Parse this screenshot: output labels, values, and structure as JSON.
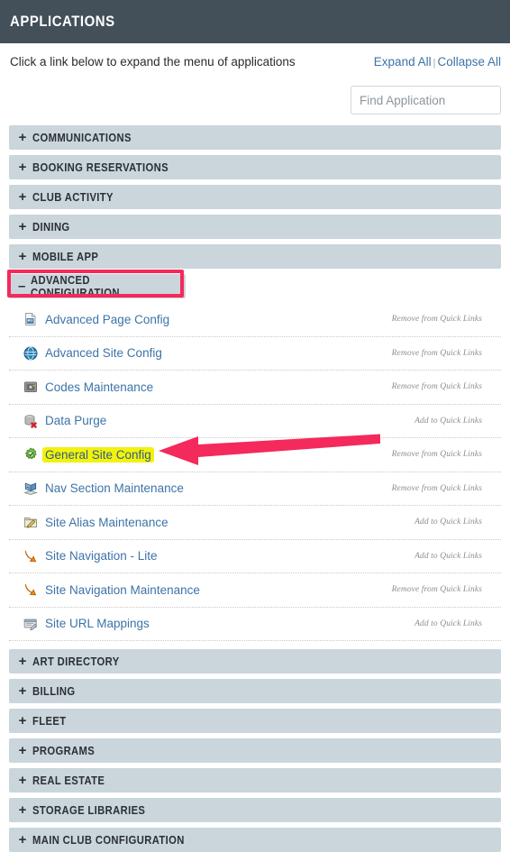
{
  "header": {
    "title": "APPLICATIONS"
  },
  "intro": {
    "hint": "Click a link below to expand the menu of applications",
    "expand_all": "Expand All",
    "separator": "|",
    "collapse_all": "Collapse All"
  },
  "search": {
    "placeholder": "Find Application",
    "value": ""
  },
  "categories_top": [
    {
      "label": "COMMUNICATIONS",
      "sign": "+",
      "expanded": false
    },
    {
      "label": "BOOKING RESERVATIONS",
      "sign": "+",
      "expanded": false
    },
    {
      "label": "CLUB ACTIVITY",
      "sign": "+",
      "expanded": false
    },
    {
      "label": "DINING",
      "sign": "+",
      "expanded": false
    },
    {
      "label": "MOBILE APP",
      "sign": "+",
      "expanded": false
    }
  ],
  "expanded_category": {
    "label": "ADVANCED CONFIGURATION",
    "sign": "–",
    "expanded": true
  },
  "applications": [
    {
      "name": "Advanced Page Config",
      "icon": "page-image-icon",
      "quick_link": "Remove from Quick Links",
      "highlighted": false
    },
    {
      "name": "Advanced Site Config",
      "icon": "globe-icon",
      "quick_link": "Remove from Quick Links",
      "highlighted": false
    },
    {
      "name": "Codes Maintenance",
      "icon": "safe-vault-icon",
      "quick_link": "Remove from Quick Links",
      "highlighted": false
    },
    {
      "name": "Data Purge",
      "icon": "database-delete-icon",
      "quick_link": "Add to Quick Links",
      "highlighted": false
    },
    {
      "name": "General Site Config",
      "icon": "gear-check-icon",
      "quick_link": "Remove from Quick Links",
      "highlighted": true
    },
    {
      "name": "Nav Section Maintenance",
      "icon": "open-book-icon",
      "quick_link": "Remove from Quick Links",
      "highlighted": false
    },
    {
      "name": "Site Alias Maintenance",
      "icon": "folder-pencil-icon",
      "quick_link": "Add to Quick Links",
      "highlighted": false
    },
    {
      "name": "Site Navigation - Lite",
      "icon": "orange-arrow-icon",
      "quick_link": "Add to Quick Links",
      "highlighted": false
    },
    {
      "name": "Site Navigation Maintenance",
      "icon": "orange-arrow-icon",
      "quick_link": "Remove from Quick Links",
      "highlighted": false
    },
    {
      "name": "Site URL Mappings",
      "icon": "url-card-icon",
      "quick_link": "Add to Quick Links",
      "highlighted": false
    }
  ],
  "categories_bottom": [
    {
      "label": "ART DIRECTORY",
      "sign": "+",
      "expanded": false
    },
    {
      "label": "BILLING",
      "sign": "+",
      "expanded": false
    },
    {
      "label": "FLEET",
      "sign": "+",
      "expanded": false
    },
    {
      "label": "PROGRAMS",
      "sign": "+",
      "expanded": false
    },
    {
      "label": "REAL ESTATE",
      "sign": "+",
      "expanded": false
    },
    {
      "label": "STORAGE LIBRARIES",
      "sign": "+",
      "expanded": false
    },
    {
      "label": "MAIN CLUB CONFIGURATION",
      "sign": "+",
      "expanded": false
    }
  ],
  "annotations": {
    "arrow": {
      "name": "pointer-arrow",
      "color": "#f4295c",
      "points_to": "General Site Config"
    },
    "highlight_box": {
      "name": "category-highlight-box",
      "color": "#f4295c",
      "around": "ADVANCED CONFIGURATION"
    },
    "text_highlight": {
      "name": "app-name-highlight",
      "color": "#f2f20d",
      "on": "General Site Config"
    }
  },
  "colors": {
    "header_bg": "#434f59",
    "category_bg": "#cbd5dc",
    "link": "#3d73a8",
    "annotation": "#f4295c",
    "highlight": "#f2f20d"
  }
}
